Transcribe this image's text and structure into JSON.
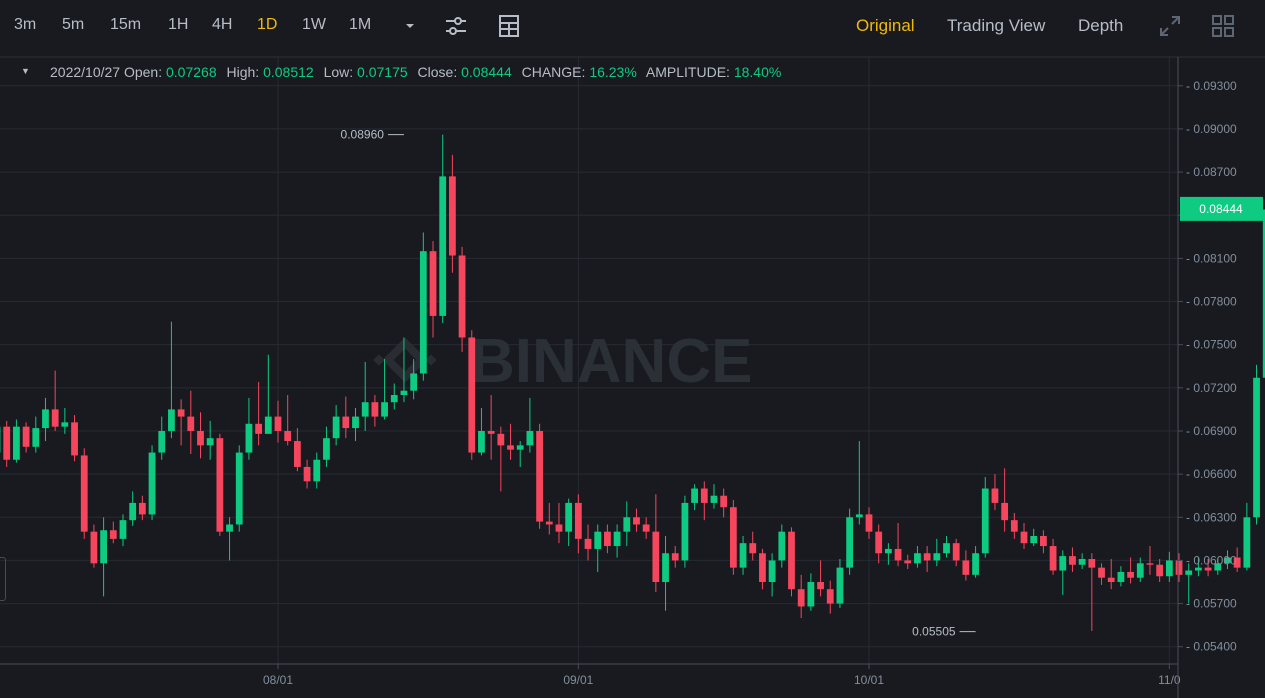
{
  "toolbar": {
    "intervals": [
      "3m",
      "5m",
      "15m",
      "1H",
      "4H",
      "1D",
      "1W",
      "1M"
    ],
    "active_interval": "1D",
    "icons": [
      "chevron-down-icon",
      "settings-sliders-icon",
      "indicator-grid-icon"
    ]
  },
  "views": {
    "original": "Original",
    "trading_view": "Trading View",
    "depth": "Depth",
    "active": "Original",
    "icons": [
      "expand-icon",
      "layout-grid-icon"
    ]
  },
  "info": {
    "date": "2022/10/27",
    "open_label": "Open:",
    "open": "0.07268",
    "high_label": "High:",
    "high": "0.08512",
    "low_label": "Low:",
    "low": "0.07175",
    "close_label": "Close:",
    "close": "0.08444",
    "change_label": "CHANGE:",
    "change": "16.23%",
    "amplitude_label": "AMPLITUDE:",
    "amplitude": "18.40%"
  },
  "watermark": "BINANCE",
  "colors": {
    "up": "#0ecb81",
    "down": "#f6465d",
    "accent": "#f0b90b",
    "background": "#181a20",
    "grid": "#262a32",
    "axis_text": "#848e9c"
  },
  "chart_data": {
    "type": "candlestick",
    "interval": "1D",
    "y_ticks": [
      "0.05400",
      "0.05700",
      "0.06000",
      "0.06300",
      "0.06600",
      "0.06900",
      "0.07200",
      "0.07500",
      "0.07800",
      "0.08100",
      "0.08400",
      "0.08700",
      "0.09000",
      "0.09300"
    ],
    "ylim": [
      0.0528,
      0.095
    ],
    "x_ticks": [
      {
        "label": "08/01",
        "date": "2022-08-01"
      },
      {
        "label": "09/01",
        "date": "2022-09-01"
      },
      {
        "label": "10/01",
        "date": "2022-10-01"
      },
      {
        "label": "11/0",
        "date": "2022-11-01"
      }
    ],
    "date_range": [
      "2022-07-03",
      "2022-10-27"
    ],
    "last_price": "0.08444",
    "annotations": [
      {
        "label": "0.08960",
        "kind": "high",
        "date": "2022-08-14"
      },
      {
        "label": "0.05505",
        "kind": "low",
        "date": "2022-10-12"
      }
    ],
    "candles": [
      [
        0.0675,
        0.0693,
        0.0697,
        0.067
      ],
      [
        0.0693,
        0.067,
        0.0697,
        0.0665
      ],
      [
        0.067,
        0.0693,
        0.0698,
        0.0668
      ],
      [
        0.0693,
        0.0679,
        0.0696,
        0.0675
      ],
      [
        0.0679,
        0.0692,
        0.07,
        0.0675
      ],
      [
        0.0692,
        0.0705,
        0.0713,
        0.0683
      ],
      [
        0.0705,
        0.0693,
        0.0732,
        0.069
      ],
      [
        0.0693,
        0.0696,
        0.0706,
        0.0688
      ],
      [
        0.0696,
        0.0673,
        0.0701,
        0.0669
      ],
      [
        0.0673,
        0.062,
        0.0678,
        0.0615
      ],
      [
        0.062,
        0.0598,
        0.0625,
        0.0595
      ],
      [
        0.0598,
        0.0621,
        0.063,
        0.0575
      ],
      [
        0.0621,
        0.0615,
        0.0627,
        0.0612
      ],
      [
        0.0615,
        0.0628,
        0.0632,
        0.061
      ],
      [
        0.0628,
        0.064,
        0.0648,
        0.0624
      ],
      [
        0.064,
        0.0632,
        0.0645,
        0.0628
      ],
      [
        0.0632,
        0.0675,
        0.068,
        0.0628
      ],
      [
        0.0675,
        0.069,
        0.07,
        0.067
      ],
      [
        0.069,
        0.0705,
        0.0766,
        0.0685
      ],
      [
        0.0705,
        0.07,
        0.0712,
        0.068
      ],
      [
        0.07,
        0.069,
        0.0718,
        0.0674
      ],
      [
        0.069,
        0.068,
        0.0703,
        0.0671
      ],
      [
        0.068,
        0.0685,
        0.0697,
        0.067
      ],
      [
        0.0685,
        0.062,
        0.0688,
        0.0617
      ],
      [
        0.062,
        0.0625,
        0.063,
        0.06
      ],
      [
        0.0625,
        0.0675,
        0.068,
        0.062
      ],
      [
        0.0675,
        0.0695,
        0.0713,
        0.067
      ],
      [
        0.0695,
        0.0688,
        0.0724,
        0.068
      ],
      [
        0.0688,
        0.07,
        0.0743,
        0.069
      ],
      [
        0.07,
        0.069,
        0.0711,
        0.0682
      ],
      [
        0.069,
        0.0683,
        0.0715,
        0.068
      ],
      [
        0.0683,
        0.0665,
        0.0692,
        0.0662
      ],
      [
        0.0665,
        0.0655,
        0.067,
        0.065
      ],
      [
        0.0655,
        0.067,
        0.0675,
        0.065
      ],
      [
        0.067,
        0.0685,
        0.0693,
        0.0665
      ],
      [
        0.0685,
        0.07,
        0.0708,
        0.068
      ],
      [
        0.07,
        0.0692,
        0.0714,
        0.0685
      ],
      [
        0.0692,
        0.07,
        0.0706,
        0.0683
      ],
      [
        0.07,
        0.071,
        0.0738,
        0.069
      ],
      [
        0.071,
        0.07,
        0.0715,
        0.0693
      ],
      [
        0.07,
        0.071,
        0.074,
        0.0698
      ],
      [
        0.071,
        0.0715,
        0.0723,
        0.0705
      ],
      [
        0.0715,
        0.0718,
        0.0755,
        0.071
      ],
      [
        0.0718,
        0.073,
        0.074,
        0.0712
      ],
      [
        0.073,
        0.0815,
        0.0828,
        0.0725
      ],
      [
        0.0815,
        0.077,
        0.0822,
        0.0755
      ],
      [
        0.077,
        0.0867,
        0.0896,
        0.0765
      ],
      [
        0.0867,
        0.0812,
        0.0882,
        0.08
      ],
      [
        0.0812,
        0.0755,
        0.0818,
        0.0745
      ],
      [
        0.0755,
        0.0675,
        0.076,
        0.067
      ],
      [
        0.0675,
        0.069,
        0.0706,
        0.0673
      ],
      [
        0.069,
        0.0688,
        0.0715,
        0.067
      ],
      [
        0.0688,
        0.068,
        0.0693,
        0.0648
      ],
      [
        0.068,
        0.0677,
        0.0695,
        0.067
      ],
      [
        0.0677,
        0.068,
        0.0683,
        0.0665
      ],
      [
        0.068,
        0.069,
        0.0713,
        0.0675
      ],
      [
        0.069,
        0.0627,
        0.0695,
        0.0622
      ],
      [
        0.0627,
        0.0625,
        0.064,
        0.0618
      ],
      [
        0.0625,
        0.062,
        0.064,
        0.0612
      ],
      [
        0.062,
        0.064,
        0.0643,
        0.061
      ],
      [
        0.064,
        0.0615,
        0.0646,
        0.0605
      ],
      [
        0.0615,
        0.0608,
        0.0625,
        0.06
      ],
      [
        0.0608,
        0.062,
        0.0625,
        0.0592
      ],
      [
        0.062,
        0.061,
        0.0625,
        0.0605
      ],
      [
        0.061,
        0.062,
        0.0625,
        0.0602
      ],
      [
        0.062,
        0.063,
        0.0641,
        0.061
      ],
      [
        0.063,
        0.0625,
        0.0636,
        0.062
      ],
      [
        0.0625,
        0.062,
        0.063,
        0.0615
      ],
      [
        0.062,
        0.0585,
        0.0646,
        0.0578
      ],
      [
        0.0585,
        0.0605,
        0.0617,
        0.0565
      ],
      [
        0.0605,
        0.06,
        0.061,
        0.0595
      ],
      [
        0.06,
        0.064,
        0.0645,
        0.0595
      ],
      [
        0.064,
        0.065,
        0.0653,
        0.0635
      ],
      [
        0.065,
        0.064,
        0.0655,
        0.0628
      ],
      [
        0.064,
        0.0645,
        0.0653,
        0.0636
      ],
      [
        0.0645,
        0.0637,
        0.065,
        0.063
      ],
      [
        0.0637,
        0.0595,
        0.0642,
        0.059
      ],
      [
        0.0595,
        0.0612,
        0.0617,
        0.059
      ],
      [
        0.0612,
        0.0605,
        0.062,
        0.06
      ],
      [
        0.0605,
        0.0585,
        0.0608,
        0.058
      ],
      [
        0.0585,
        0.06,
        0.0605,
        0.0575
      ],
      [
        0.06,
        0.062,
        0.0625,
        0.0595
      ],
      [
        0.062,
        0.058,
        0.0623,
        0.0575
      ],
      [
        0.058,
        0.0568,
        0.059,
        0.056
      ],
      [
        0.0568,
        0.0585,
        0.0591,
        0.0565
      ],
      [
        0.0585,
        0.058,
        0.06,
        0.0575
      ],
      [
        0.058,
        0.057,
        0.0586,
        0.0563
      ],
      [
        0.057,
        0.0595,
        0.0601,
        0.0567
      ],
      [
        0.0595,
        0.063,
        0.0636,
        0.059
      ],
      [
        0.063,
        0.0632,
        0.0683,
        0.0625
      ],
      [
        0.0632,
        0.062,
        0.0637,
        0.0615
      ],
      [
        0.062,
        0.0605,
        0.0625,
        0.0598
      ],
      [
        0.0605,
        0.0608,
        0.0612,
        0.0597
      ],
      [
        0.0608,
        0.06,
        0.0626,
        0.0596
      ],
      [
        0.06,
        0.0598,
        0.0604,
        0.0594
      ],
      [
        0.0598,
        0.0605,
        0.061,
        0.0595
      ],
      [
        0.0605,
        0.06,
        0.061,
        0.0592
      ],
      [
        0.06,
        0.0605,
        0.0615,
        0.0596
      ],
      [
        0.0605,
        0.0612,
        0.0617,
        0.0602
      ],
      [
        0.0612,
        0.06,
        0.0615,
        0.0596
      ],
      [
        0.06,
        0.059,
        0.0607,
        0.0586
      ],
      [
        0.059,
        0.0605,
        0.061,
        0.0588
      ],
      [
        0.0605,
        0.065,
        0.0658,
        0.0602
      ],
      [
        0.065,
        0.064,
        0.066,
        0.0635
      ],
      [
        0.064,
        0.0628,
        0.0664,
        0.062
      ],
      [
        0.0628,
        0.062,
        0.0633,
        0.0615
      ],
      [
        0.062,
        0.0612,
        0.0626,
        0.0608
      ],
      [
        0.0612,
        0.0617,
        0.0622,
        0.061
      ],
      [
        0.0617,
        0.061,
        0.0621,
        0.0605
      ],
      [
        0.061,
        0.0593,
        0.0615,
        0.059
      ],
      [
        0.0593,
        0.0603,
        0.0607,
        0.0576
      ],
      [
        0.0603,
        0.0597,
        0.0609,
        0.0592
      ],
      [
        0.0597,
        0.0601,
        0.0605,
        0.0594
      ],
      [
        0.0601,
        0.0595,
        0.0605,
        0.0551
      ],
      [
        0.0595,
        0.0588,
        0.0598,
        0.0583
      ],
      [
        0.0588,
        0.0585,
        0.0601,
        0.058
      ],
      [
        0.0585,
        0.0592,
        0.0596,
        0.0582
      ],
      [
        0.0592,
        0.0588,
        0.0602,
        0.0584
      ],
      [
        0.0588,
        0.0598,
        0.0602,
        0.0585
      ],
      [
        0.0598,
        0.0597,
        0.061,
        0.059
      ],
      [
        0.0597,
        0.0589,
        0.0601,
        0.0585
      ],
      [
        0.0589,
        0.06,
        0.0606,
        0.0585
      ],
      [
        0.06,
        0.059,
        0.0605,
        0.0585
      ],
      [
        0.059,
        0.0593,
        0.0598,
        0.057
      ],
      [
        0.0593,
        0.0595,
        0.0602,
        0.0589
      ],
      [
        0.0595,
        0.0593,
        0.0601,
        0.0589
      ],
      [
        0.0593,
        0.0598,
        0.0601,
        0.059
      ],
      [
        0.0598,
        0.0602,
        0.0607,
        0.0594
      ],
      [
        0.0602,
        0.0595,
        0.0609,
        0.0592
      ],
      [
        0.0595,
        0.063,
        0.064,
        0.0593
      ],
      [
        0.063,
        0.0727,
        0.0736,
        0.0625
      ],
      [
        0.0727,
        0.0844,
        0.0851,
        0.0717
      ]
    ]
  }
}
